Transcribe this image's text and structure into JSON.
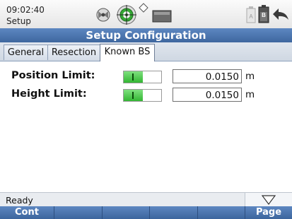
{
  "status": {
    "time": "09:02:40",
    "mode": "Setup"
  },
  "header": {
    "title": "Setup Configuration"
  },
  "tabs": [
    {
      "label": "General"
    },
    {
      "label": "Resection"
    },
    {
      "label": "Known BS"
    }
  ],
  "rows": [
    {
      "label": "Position Limit:",
      "toggle_on": true,
      "value": "0.0150",
      "unit": "m"
    },
    {
      "label": "Height Limit:",
      "toggle_on": true,
      "value": "0.0150",
      "unit": "m"
    }
  ],
  "statusbar": {
    "text": "Ready"
  },
  "softkeys": {
    "f1": "Cont",
    "f2": "",
    "f3": "",
    "f4": "",
    "f5": "",
    "f6": "Page"
  },
  "colors": {
    "title_bar": "#4a73ad",
    "toggle_on": "#4cc44c",
    "softkey_bar": "#4a73ad"
  },
  "icons": [
    "satellite-icon",
    "prism-target-icon",
    "signal-icon",
    "memory-card-icon",
    "battery-a-icon",
    "battery-b-icon",
    "back-arrow-icon",
    "scroll-down-icon"
  ]
}
